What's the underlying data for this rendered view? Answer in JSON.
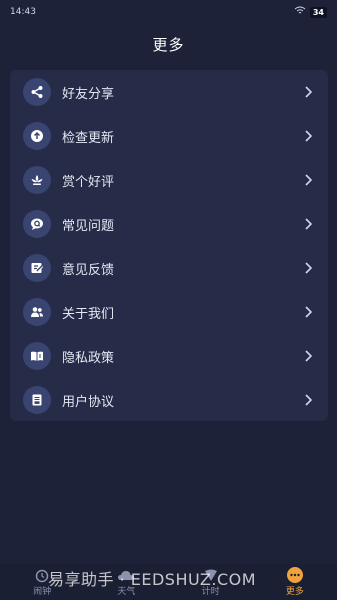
{
  "status": {
    "time": "14:43",
    "battery": "34"
  },
  "header": {
    "title": "更多"
  },
  "menu": {
    "items": [
      {
        "label": "好友分享",
        "icon": "share-icon"
      },
      {
        "label": "检查更新",
        "icon": "upload-icon"
      },
      {
        "label": "赏个好评",
        "icon": "lotus-icon"
      },
      {
        "label": "常见问题",
        "icon": "question-chat-icon"
      },
      {
        "label": "意见反馈",
        "icon": "feedback-edit-icon"
      },
      {
        "label": "关于我们",
        "icon": "users-icon"
      },
      {
        "label": "隐私政策",
        "icon": "book-icon"
      },
      {
        "label": "用户协议",
        "icon": "document-icon"
      }
    ]
  },
  "tabbar": {
    "tabs": [
      {
        "label": "闹钟",
        "icon": "alarm-icon",
        "active": false
      },
      {
        "label": "天气",
        "icon": "weather-icon",
        "active": false
      },
      {
        "label": "计时",
        "icon": "timer-icon",
        "active": false
      },
      {
        "label": "更多",
        "icon": "more-icon",
        "active": true
      }
    ]
  },
  "watermark": "易享助手 · EEDSHUZ.COM",
  "colors": {
    "background": "#1d2238",
    "card": "#262c47",
    "icon_bg": "#3a4470",
    "accent": "#f0a33a"
  }
}
